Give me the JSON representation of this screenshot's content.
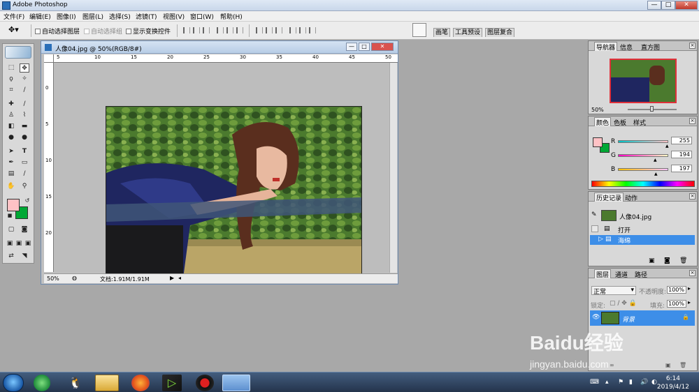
{
  "app": {
    "title": "Adobe Photoshop",
    "minimize": "—",
    "maximize": "□",
    "close": "✕"
  },
  "menu": [
    "文件(F)",
    "编辑(E)",
    "图像(I)",
    "图层(L)",
    "选择(S)",
    "滤镜(T)",
    "视图(V)",
    "窗口(W)",
    "帮助(H)"
  ],
  "options": {
    "auto_select_layer": "自动选择图层",
    "auto_select_group": "自动选择组",
    "show_transform": "显示变换控件",
    "palette_tabs": [
      "画笔",
      "工具预设",
      "图层复合"
    ]
  },
  "document": {
    "title": "人像04.jpg @ 50%(RGB/8#)",
    "zoom": "50%",
    "status": "文档:1.91M/1.91M",
    "ruler_h": [
      "5",
      "10",
      "15",
      "20",
      "25",
      "30",
      "35",
      "40",
      "45",
      "50"
    ],
    "ruler_v": [
      "0",
      "5",
      "10",
      "15",
      "20"
    ]
  },
  "navigator": {
    "tabs": [
      "导航器",
      "信息",
      "直方图"
    ],
    "zoom": "50%"
  },
  "color": {
    "tabs": [
      "颜色",
      "色板",
      "样式"
    ],
    "r_label": "R",
    "g_label": "G",
    "b_label": "B",
    "r": "255",
    "g": "194",
    "b": "197",
    "fg": "#ffc2c5",
    "bg": "#00a835"
  },
  "history": {
    "tabs": [
      "历史记录",
      "动作"
    ],
    "snapshot": "人像04.jpg",
    "items": [
      "打开",
      "海绵"
    ]
  },
  "layers": {
    "tabs": [
      "图层",
      "通道",
      "路径"
    ],
    "blend": "正常",
    "opacity_label": "不透明度:",
    "opacity": "100%",
    "lock_label": "锁定:",
    "fill_label": "填充:",
    "fill": "100%",
    "layer_name": "背景"
  },
  "taskbar": {
    "time": "6:14",
    "date": "2019/4/12"
  },
  "watermark": {
    "brand": "Baidu经验",
    "url": "jingyan.baidu.com"
  }
}
